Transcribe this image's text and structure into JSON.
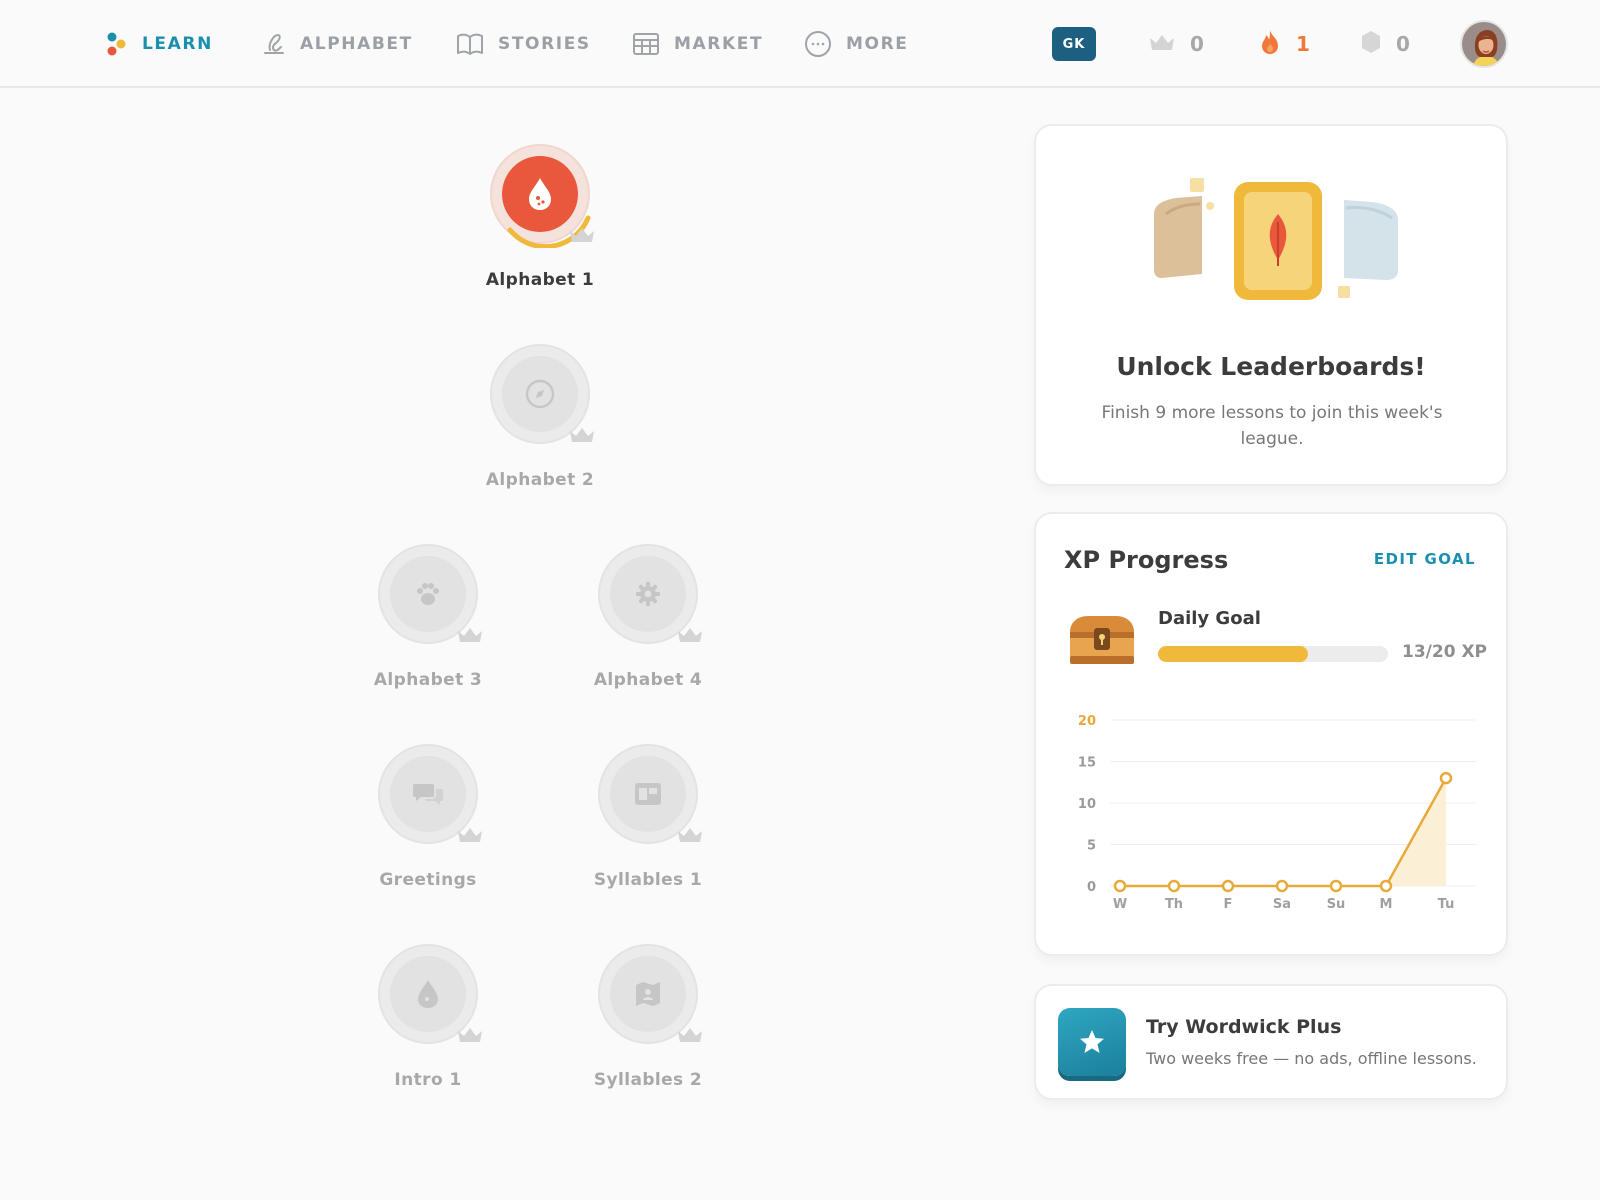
{
  "nav": {
    "items": [
      {
        "label": "LEARN",
        "icon": "learn-dots-icon",
        "active": true
      },
      {
        "label": "ALPHABET",
        "icon": "pen-icon",
        "active": false
      },
      {
        "label": "STORIES",
        "icon": "book-icon",
        "active": false
      },
      {
        "label": "MARKET",
        "icon": "store-icon",
        "active": false
      },
      {
        "label": "MORE",
        "icon": "more-icon",
        "active": false
      }
    ],
    "language_badge": "GK",
    "crowns": "0",
    "streak": "1",
    "gems": "0"
  },
  "skills": [
    {
      "label": "Alphabet 1",
      "icon": "drop-icon",
      "active": true
    },
    {
      "label": "Alphabet 2",
      "icon": "compass-icon",
      "active": false
    },
    {
      "label": "Alphabet 3",
      "icon": "paw-icon",
      "active": false
    },
    {
      "label": "Alphabet 4",
      "icon": "gear-icon",
      "active": false
    },
    {
      "label": "Greetings",
      "icon": "chat-icon",
      "active": false
    },
    {
      "label": "Syllables 1",
      "icon": "tile-icon",
      "active": false
    },
    {
      "label": "Intro 1",
      "icon": "drop-icon",
      "active": false
    },
    {
      "label": "Syllables 2",
      "icon": "map-icon",
      "active": false
    }
  ],
  "leaderboard": {
    "title": "Unlock Leaderboards!",
    "description": "Finish 9 more lessons to join this week's league."
  },
  "xp": {
    "title": "XP Progress",
    "edit_goal": "EDIT GOAL",
    "daily_goal_label": "Daily Goal",
    "current": 13,
    "goal": 20,
    "progress_text": "13/20 XP"
  },
  "chart_data": {
    "type": "area",
    "categories": [
      "W",
      "Th",
      "F",
      "Sa",
      "Su",
      "M",
      "Tu"
    ],
    "values": [
      0,
      0,
      0,
      0,
      0,
      0,
      13
    ],
    "yticks": [
      0,
      5,
      10,
      15,
      20
    ],
    "ylim": [
      0,
      20
    ],
    "highlight_tick": 20,
    "colors": {
      "line": "#e8a93a",
      "fill": "#fbf0d6",
      "highlight": "#e8a93a"
    }
  },
  "plus": {
    "title": "Try Wordwick Plus",
    "subtitle": "Two weeks free — no ads, offline lessons."
  },
  "colors": {
    "accent": "#1a8fae",
    "streak": "#f0783c",
    "active_skill": "#e9583c",
    "progress": "#f0b93c"
  }
}
